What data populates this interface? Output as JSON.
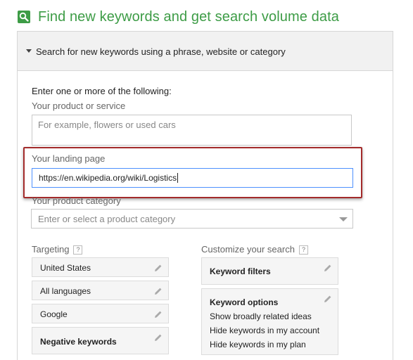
{
  "header": {
    "icon": "search-icon",
    "title": "Find new keywords and get search volume data",
    "accent_color": "#3d9c46"
  },
  "panel": {
    "section_label": "Search for new keywords using a phrase, website or category",
    "intro": "Enter one or more of the following:",
    "product": {
      "label": "Your product or service",
      "placeholder": "For example, flowers or used cars",
      "value": ""
    },
    "landing": {
      "label": "Your landing page",
      "value": "https://en.wikipedia.org/wiki/Logistics",
      "highlight_color": "#a32b2b"
    },
    "category": {
      "label": "Your product category",
      "placeholder": "Enter or select a product category"
    },
    "targeting": {
      "label": "Targeting",
      "help": "?",
      "items": [
        "United States",
        "All languages",
        "Google",
        "Negative keywords"
      ]
    },
    "customize": {
      "label": "Customize your search",
      "help": "?",
      "filters_label": "Keyword filters",
      "options_label": "Keyword options",
      "options": [
        "Show broadly related ideas",
        "Hide keywords in my account",
        "Hide keywords in my plan"
      ]
    }
  }
}
